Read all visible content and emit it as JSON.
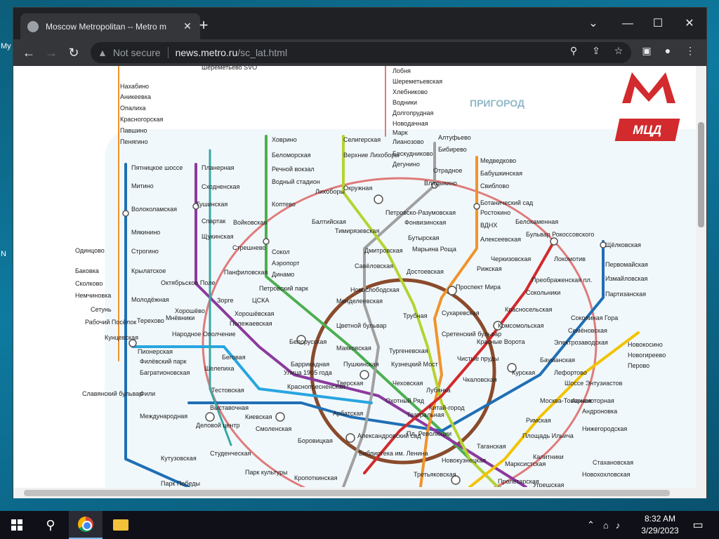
{
  "desktop": {
    "edge_labels": [
      "My",
      "N"
    ]
  },
  "browser": {
    "tab_title": "Moscow Metropolitan -- Metro m",
    "url_not_secure": "Not secure",
    "url_host": "news.metro.ru",
    "url_path": "/sc_lat.html"
  },
  "map": {
    "region_label": "ПРИГОРОД",
    "mcd_logo": "МЦД",
    "stations": [
      "Нахабино",
      "Аникеевка",
      "Опалиха",
      "Красногорская",
      "Павшино",
      "Пенягино",
      "Шереметьево SVO",
      "Лобня",
      "Шереметьевская",
      "Хлебниково",
      "Водники",
      "Долгопрудная",
      "Новодачная",
      "Марк",
      "Лианозово",
      "Бескудниково",
      "Дегунино",
      "Алтуфьево",
      "Бибирево",
      "Отрадное",
      "Владыкино",
      "Медведково",
      "Бабушкинская",
      "Свиблово",
      "Ботанический сад",
      "Ростокино",
      "Белокаменная",
      "ВДНХ",
      "Алексеевская",
      "Пятницкое шоссе",
      "Митино",
      "Волоколамская",
      "Мякинино",
      "Строгино",
      "Крылатское",
      "Молодёжная",
      "Планерная",
      "Сходненская",
      "Тушинская",
      "Спартак",
      "Щукинская",
      "Октябрьское Поле",
      "Ховрино",
      "Беломорская",
      "Речной вокзал",
      "Водный стадион",
      "Войковская",
      "Сокол",
      "Аэропорт",
      "Динамо",
      "Селигерская",
      "Верхние Лихоборы",
      "Окружная",
      "Лихоборы",
      "Коптево",
      "Балтийская",
      "Стрешнево",
      "Панфиловская",
      "Петровско-Разумовская",
      "Фонвизинская",
      "Бутырская",
      "Тимирязевская",
      "Дмитровская",
      "Савёловская",
      "Марьина Роща",
      "Достоевская",
      "Бульвар Рокоссовского",
      "Черкизовская",
      "Локомотив",
      "Преображенская пл.",
      "Сокольники",
      "Красносельская",
      "Щёлковская",
      "Первомайская",
      "Измайловская",
      "Партизанская",
      "Рижская",
      "Проспект Мира",
      "Сухаревская",
      "Комсомольская",
      "Красные Ворота",
      "Чистые пруды",
      "Тургеневская",
      "Сретенский бульвар",
      "Новослободская",
      "Менделеевская",
      "Цветной бульвар",
      "Трубная",
      "Маяковская",
      "Белорусская",
      "Пушкинская",
      "Тверская",
      "Чеховская",
      "Кузнецкий Мост",
      "Лубянка",
      "Баррикадная",
      "Краснопресненская",
      "Улица 1905 года",
      "Беговая",
      "Полежаевская",
      "Хорошёвская",
      "Зорге",
      "ЦСКА",
      "Петровский парк",
      "Хорошёво",
      "Одинцово",
      "Баковка",
      "Сколково",
      "Немчиновка",
      "Сетунь",
      "Рабочий Посёлок",
      "Кунцевская",
      "Пионерская",
      "Филёвский парк",
      "Багратионовская",
      "Фили",
      "Славянский бульвар",
      "Народное Ополчение",
      "Мнёвники",
      "Терехово",
      "Шелепиха",
      "Тестовская",
      "Выставочная",
      "Деловой центр",
      "Международная",
      "Киевская",
      "Смоленская",
      "Арбатская",
      "Александровский сад",
      "Библиотека им. Ленина",
      "Боровицкая",
      "Охотный Ряд",
      "Театральная",
      "Пл. Революции",
      "Китай-город",
      "Кропоткинская",
      "Парк культуры",
      "Студенческая",
      "Кутузовская",
      "Парк Победы",
      "Курская",
      "Чкаловская",
      "Бауманская",
      "Лефортово",
      "Электрозаводская",
      "Семёновская",
      "Соколиная Гора",
      "Шоссе Энтузиастов",
      "Авиамоторная",
      "Андроновка",
      "Нижегородская",
      "Москва-Товарная",
      "Римская",
      "Площадь Ильича",
      "Таганская",
      "Марксистская",
      "Новокузнецкая",
      "Третьяковская",
      "Пролетарская",
      "Крестьянская застава",
      "Калитники",
      "Новохохловская",
      "Угрешская",
      "Стахановская",
      "Новокосино",
      "Новогиреево",
      "Перово"
    ]
  },
  "taskbar": {
    "time": "8:32 AM",
    "date": "3/29/2023"
  },
  "colors": {
    "accent_red": "#d22a2d",
    "line_green": "#4caf50",
    "line_blue": "#1f6fb5",
    "line_brown": "#8a4b2c",
    "line_orange": "#f0932b",
    "line_purple": "#8b3a9e",
    "line_yellow": "#f2c300",
    "line_lightblue": "#27a5df",
    "line_lime": "#b5d334"
  }
}
